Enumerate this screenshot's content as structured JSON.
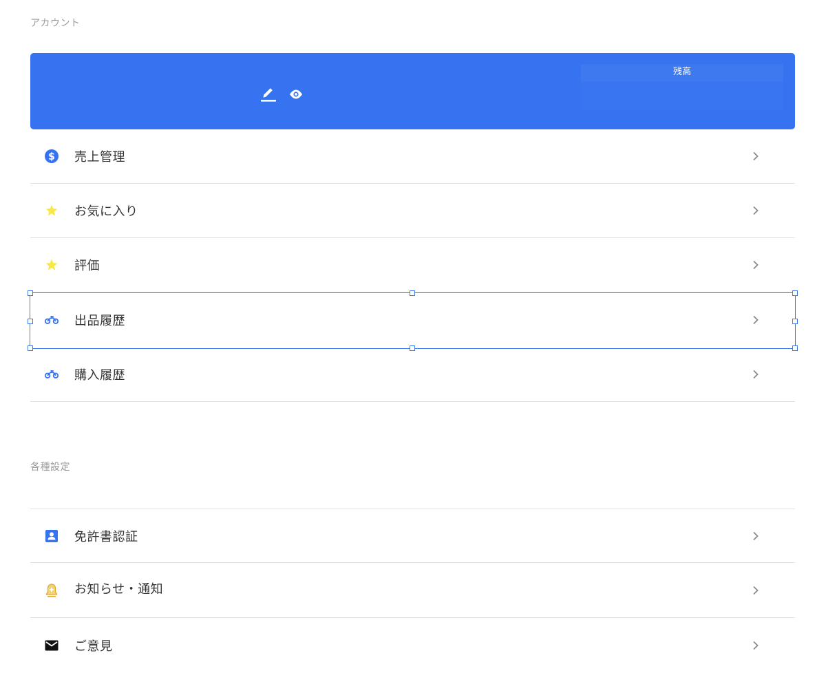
{
  "sections": {
    "account_title": "アカウント",
    "settings_title": "各種設定"
  },
  "profile": {
    "balance_label": "残高",
    "edit_icon": "pencil-icon",
    "view_icon": "eye-icon",
    "card_color": "#3673f0"
  },
  "account_menu": [
    {
      "label": "売上管理",
      "icon": "dollar-circle-icon",
      "icon_color": "#3673f0"
    },
    {
      "label": "お気に入り",
      "icon": "star-icon",
      "icon_color": "#f7e84a"
    },
    {
      "label": "評価",
      "icon": "star-icon",
      "icon_color": "#f7e84a"
    },
    {
      "label": "出品履歴",
      "icon": "motorcycle-icon",
      "icon_color": "#3673f0"
    },
    {
      "label": "購入履歴",
      "icon": "motorcycle-icon",
      "icon_color": "#3673f0"
    }
  ],
  "settings_menu": [
    {
      "label": "免許書認証",
      "icon": "id-card-icon",
      "icon_color": "#3673f0"
    },
    {
      "label": "お知らせ・通知",
      "icon": "bell-icon",
      "icon_color": "#f0b429"
    },
    {
      "label": "ご意見",
      "icon": "mail-icon",
      "icon_color": "#111111"
    }
  ],
  "colors": {
    "accent": "#3673f0",
    "selection": "#3d7be8",
    "divider": "#e2e2e2",
    "chevron": "#8a8a8a"
  }
}
